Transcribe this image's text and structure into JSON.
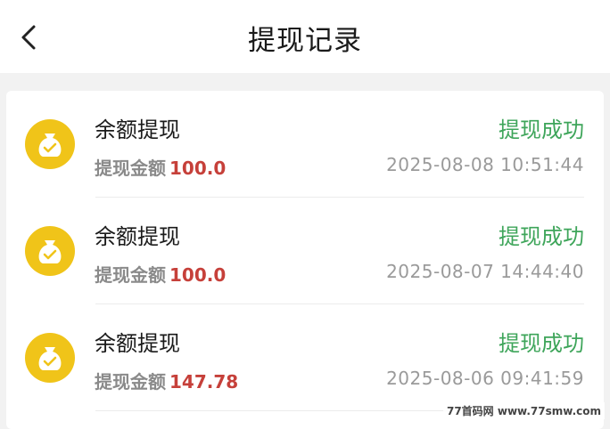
{
  "header": {
    "title": "提现记录",
    "back_icon": "chevron-left-icon"
  },
  "colors": {
    "status_success": "#3ea55a",
    "amount_red": "#c6403a",
    "coin_yellow": "#f0c419"
  },
  "records": [
    {
      "title": "余额提现",
      "amount_label": "提现金额",
      "amount": "100.0",
      "status": "提现成功",
      "time": "2025-08-08 10:51:44",
      "icon": "money-bag-check-icon"
    },
    {
      "title": "余额提现",
      "amount_label": "提现金额",
      "amount": "100.0",
      "status": "提现成功",
      "time": "2025-08-07 14:44:40",
      "icon": "money-bag-check-icon"
    },
    {
      "title": "余额提现",
      "amount_label": "提现金额",
      "amount": "147.78",
      "status": "提现成功",
      "time": "2025-08-06 09:41:59",
      "icon": "money-bag-check-icon"
    }
  ],
  "watermark": "77首码网 www.77smw.com"
}
